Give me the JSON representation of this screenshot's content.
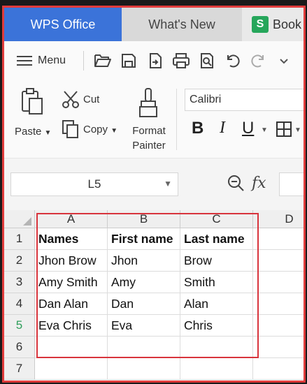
{
  "tabs": {
    "wps": "WPS Office",
    "whats_new": "What's New",
    "book": "Book",
    "book_badge": "S"
  },
  "toolbar": {
    "menu_label": "Menu"
  },
  "ribbon": {
    "paste": "Paste",
    "cut": "Cut",
    "copy": "Copy",
    "format_painter_line1": "Format",
    "format_painter_line2": "Painter",
    "font_name": "Calibri",
    "bold": "B",
    "italic": "I",
    "underline": "U"
  },
  "formula_bar": {
    "cell_ref": "L5",
    "fx": "fx"
  },
  "sheet": {
    "columns": [
      "A",
      "B",
      "C",
      "D"
    ],
    "rows": [
      "1",
      "2",
      "3",
      "4",
      "5",
      "6",
      "7"
    ],
    "active_row": "5",
    "cells": [
      [
        "Names",
        "First name",
        "Last name",
        ""
      ],
      [
        "Jhon Brow",
        "Jhon",
        "Brow",
        ""
      ],
      [
        "Amy Smith",
        "Amy",
        "Smith",
        ""
      ],
      [
        "Dan Alan",
        "Dan",
        "Alan",
        ""
      ],
      [
        "Eva Chris",
        "Eva",
        "Chris",
        ""
      ],
      [
        "",
        "",
        "",
        ""
      ],
      [
        "",
        "",
        "",
        ""
      ]
    ]
  },
  "colors": {
    "accent_tab": "#3b73d9",
    "selection": "#d8343c",
    "frame": "#e03c3c",
    "sheets_badge": "#26a65b"
  }
}
